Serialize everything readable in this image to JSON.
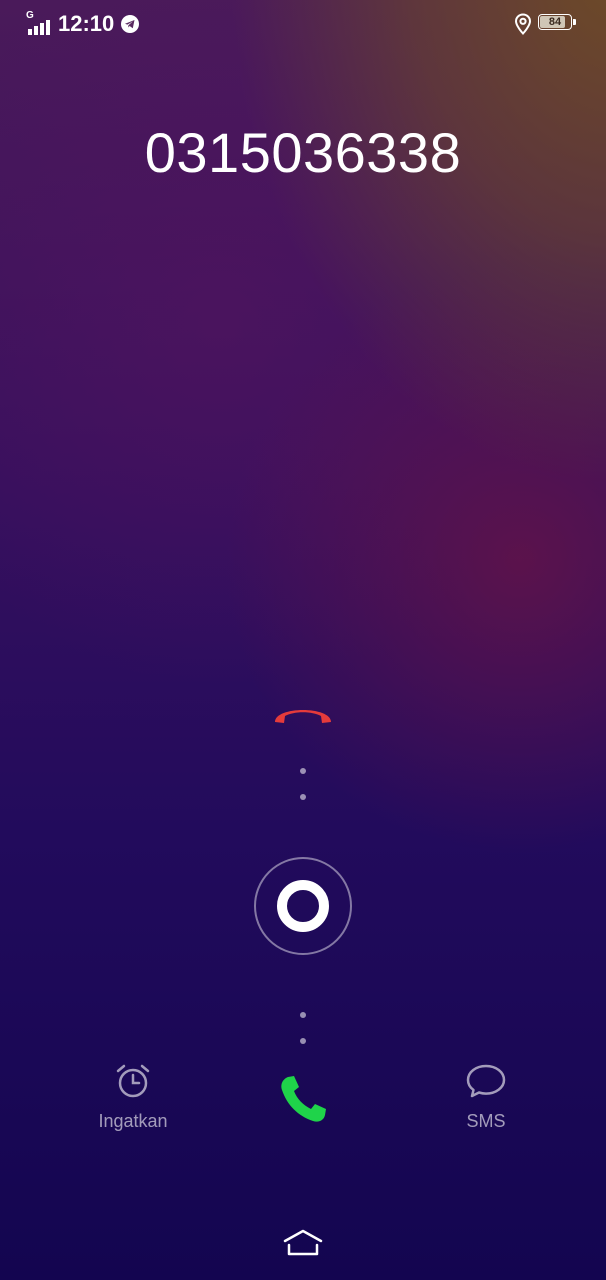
{
  "status_bar": {
    "network_type": "G",
    "time": "12:10",
    "notification_icon": "telegram-icon",
    "location_icon": "location-pin-icon",
    "battery_level": "84"
  },
  "call": {
    "caller_number": "0315036338"
  },
  "actions": {
    "decline_icon": "phone-hangup-icon",
    "slider_handle_icon": "ring-handle-icon",
    "answer_icon": "phone-answer-icon",
    "remind_label": "Ingatkan",
    "remind_icon": "alarm-clock-icon",
    "sms_label": "SMS",
    "sms_icon": "chat-bubble-icon"
  },
  "navigation": {
    "home_icon": "home-chevron-icon"
  },
  "colors": {
    "decline": "#e53b3b",
    "answer": "#1fd34a",
    "text": "#ffffff"
  }
}
